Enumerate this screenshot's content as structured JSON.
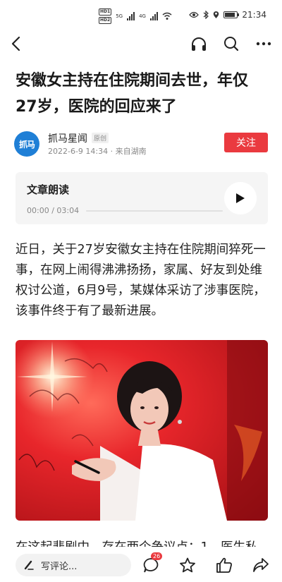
{
  "status_bar": {
    "hd1": "HD",
    "hd1_sub": "1",
    "hd2": "HD",
    "hd2_sub": "2",
    "net1": "5G",
    "net2": "4G",
    "time": "21:34"
  },
  "article": {
    "title": "安徽女主持在住院期间去世，年仅27岁，医院的回应来了",
    "author": {
      "avatar_text": "抓马",
      "name": "抓马星闻",
      "badge": "原创",
      "meta": "2022-6-9 14:34 · 来自湖南"
    },
    "follow_label": "关注",
    "audio": {
      "title": "文章朗读",
      "time": "00:00 / 03:04",
      "progress": 0
    },
    "paragraph1": "近日，关于27岁安徽女主持在住院期间猝死一事，在网上闹得沸沸扬扬，家属、好友到处维权讨公道，6月9号，某媒体采访了涉事医院，该事件终于有了最新进展。",
    "paragraph2_partial": "在这起悲剧中，存在两个争议点：1、医生私"
  },
  "bottom_bar": {
    "comment_placeholder": "写评论...",
    "comment_count": "26"
  },
  "colors": {
    "accent": "#ea3a3f",
    "avatar_bg": "#1f7fd6",
    "card_bg": "#f5f5f5",
    "photo_bg": "#e8262b"
  },
  "icons": [
    "back-icon",
    "headphones-icon",
    "search-icon",
    "more-icon",
    "play-icon",
    "pen-icon",
    "comment-icon",
    "star-icon",
    "thumbs-up-icon",
    "share-icon"
  ]
}
